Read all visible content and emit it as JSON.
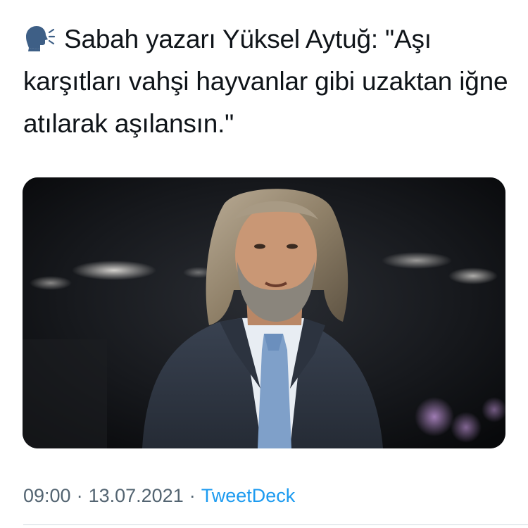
{
  "tweet": {
    "emoji_icon": "speaking-head-icon",
    "text": "Sabah yazarı Yüksel Aytuğ: \"Aşı karşıtları vahşi hayvanlar gibi uzaktan iğne atılarak aşılansın.\""
  },
  "media": {
    "alt": "Photo of a long-haired, bearded man in a dark suit and blue tie"
  },
  "meta": {
    "time": "09:00",
    "separator": "·",
    "date": "13.07.2021",
    "source": "TweetDeck"
  },
  "colors": {
    "text": "#0f1419",
    "secondary": "#536471",
    "link": "#1d9bf0"
  }
}
